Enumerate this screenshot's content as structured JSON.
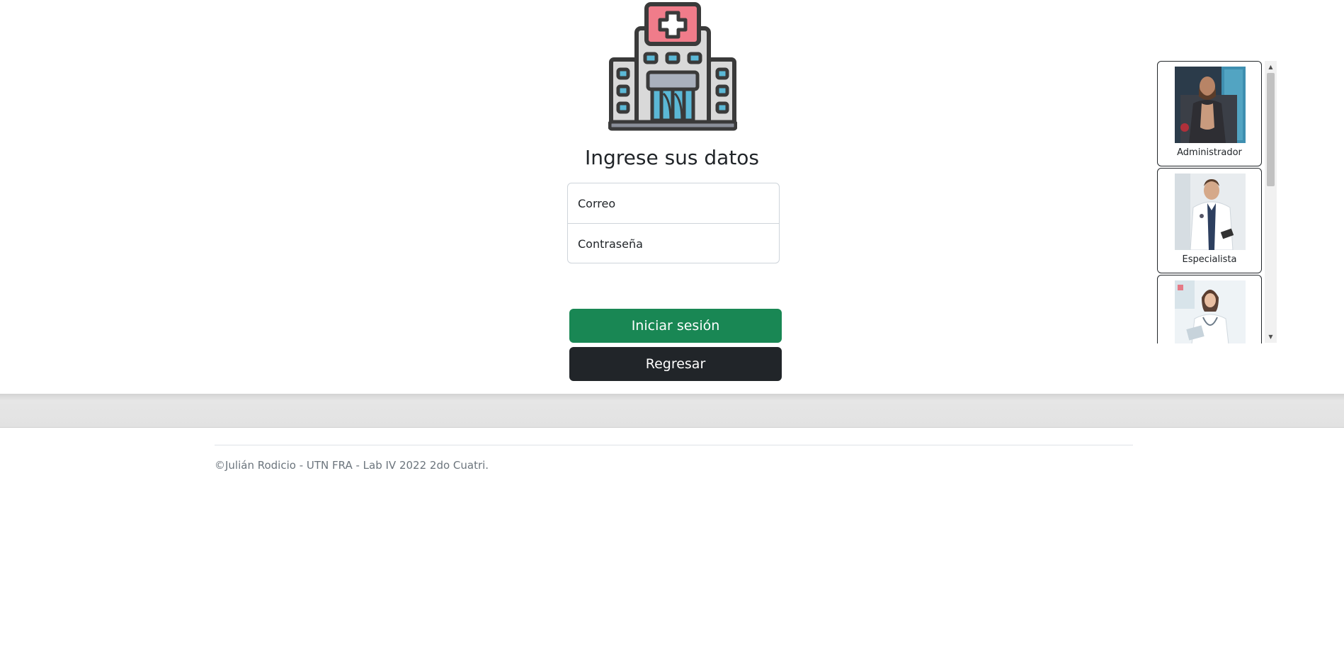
{
  "login": {
    "title": "Ingrese sus datos",
    "email_placeholder": "Correo",
    "password_placeholder": "Contraseña",
    "login_button": "Iniciar sesión",
    "back_button": "Regresar"
  },
  "quick_access": {
    "profiles": [
      {
        "label": "Administrador"
      },
      {
        "label": "Especialista"
      },
      {
        "label": ""
      }
    ]
  },
  "footer": {
    "text": "©Julián Rodicio - UTN FRA - Lab IV 2022 2do Cuatri."
  },
  "colors": {
    "login_button": "#198754",
    "back_button": "#212529",
    "logo_cross_box": "#f07c8a",
    "logo_window": "#5bb8d6",
    "logo_outline": "#3a3a3a"
  },
  "icons": {
    "logo": "hospital-building-icon",
    "scroll_up": "scroll-up-arrow-icon",
    "scroll_down": "scroll-down-arrow-icon"
  }
}
